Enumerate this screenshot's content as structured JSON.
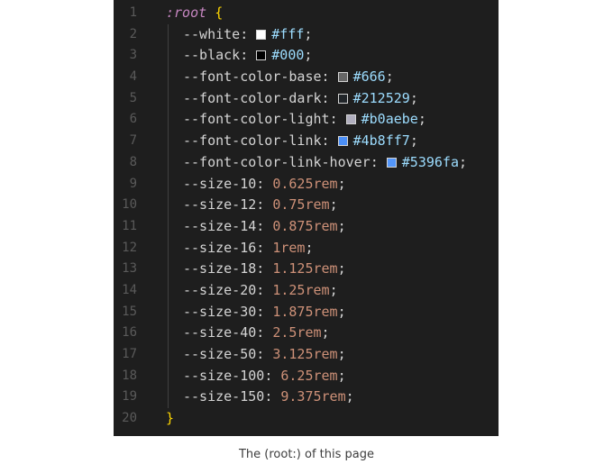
{
  "code": {
    "selector": ":root",
    "open_brace": "{",
    "close_brace": "}",
    "line_numbers": [
      "1",
      "2",
      "3",
      "4",
      "5",
      "6",
      "7",
      "8",
      "9",
      "10",
      "11",
      "12",
      "13",
      "14",
      "15",
      "16",
      "17",
      "18",
      "19",
      "20"
    ],
    "declarations": [
      {
        "name": "--white",
        "value": "#fff",
        "is_color": true,
        "swatch": "#ffffff"
      },
      {
        "name": "--black",
        "value": "#000",
        "is_color": true,
        "swatch": "#000000"
      },
      {
        "name": "--font-color-base",
        "value": "#666",
        "is_color": true,
        "swatch": "#666666"
      },
      {
        "name": "--font-color-dark",
        "value": "#212529",
        "is_color": true,
        "swatch": "#212529"
      },
      {
        "name": "--font-color-light",
        "value": "#b0aebe",
        "is_color": true,
        "swatch": "#b0aebe"
      },
      {
        "name": "--font-color-link",
        "value": "#4b8ff7",
        "is_color": true,
        "swatch": "#4b8ff7"
      },
      {
        "name": "--font-color-link-hover",
        "value": "#5396fa",
        "is_color": true,
        "swatch": "#5396fa"
      },
      {
        "name": "--size-10",
        "value": "0.625rem",
        "is_color": false
      },
      {
        "name": "--size-12",
        "value": "0.75rem",
        "is_color": false
      },
      {
        "name": "--size-14",
        "value": "0.875rem",
        "is_color": false
      },
      {
        "name": "--size-16",
        "value": "1rem",
        "is_color": false
      },
      {
        "name": "--size-18",
        "value": "1.125rem",
        "is_color": false
      },
      {
        "name": "--size-20",
        "value": "1.25rem",
        "is_color": false
      },
      {
        "name": "--size-30",
        "value": "1.875rem",
        "is_color": false
      },
      {
        "name": "--size-40",
        "value": "2.5rem",
        "is_color": false
      },
      {
        "name": "--size-50",
        "value": "3.125rem",
        "is_color": false
      },
      {
        "name": "--size-100",
        "value": "6.25rem",
        "is_color": false
      },
      {
        "name": "--size-150",
        "value": "9.375rem",
        "is_color": false
      }
    ]
  },
  "caption": "The (root:) of this page",
  "colors": {
    "editor_background": "#1e1e1e",
    "selector": "#c586c0",
    "brace": "#ffd700",
    "hex_value": "#9cdcfe",
    "number_value": "#ce9178"
  }
}
